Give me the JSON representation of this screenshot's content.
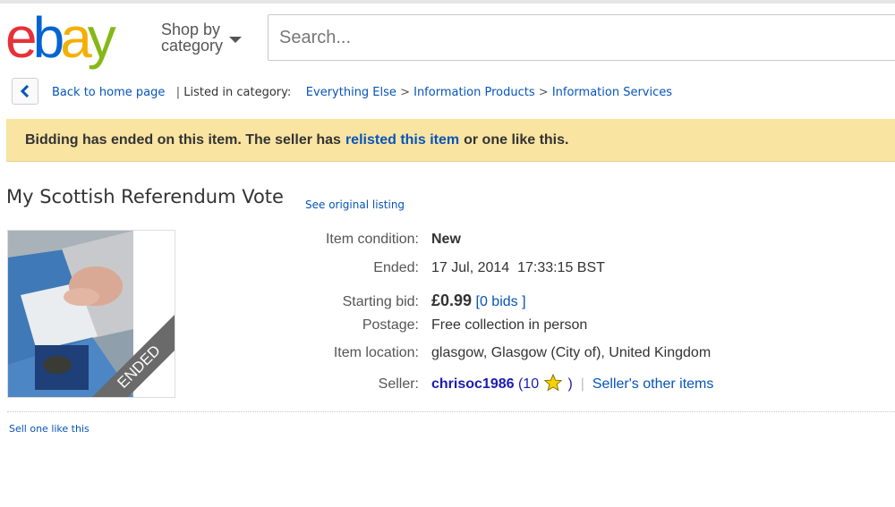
{
  "header": {
    "logo_letters": [
      "e",
      "b",
      "a",
      "y"
    ],
    "shop_by_category": "Shop by category",
    "search_placeholder": "Search..."
  },
  "breadcrumb": {
    "back_label": "Back to home page",
    "separator": "|",
    "listed_in": "Listed in category:",
    "categories": [
      "Everything Else",
      "Information Products",
      "Information Services"
    ],
    "arrow": ">"
  },
  "notice": {
    "text_before": "Bidding has ended on this item. The seller has",
    "link": "relisted this item",
    "text_after": "or one like this."
  },
  "listing": {
    "title": "My Scottish Referendum Vote",
    "see_original": "See original listing",
    "ribbon": "ENDED"
  },
  "details": {
    "condition": {
      "label": "Item condition:",
      "value": "New"
    },
    "ended": {
      "label": "Ended:",
      "value": "17 Jul, 2014  17:33:15 BST"
    },
    "starting_bid": {
      "label": "Starting bid:",
      "value": "£0.99",
      "bids_open": "[",
      "bids": "0 bids",
      "bids_close": "]"
    },
    "postage": {
      "label": "Postage:",
      "value": "Free collection in person"
    },
    "location": {
      "label": "Item location:",
      "value": "glasgow, Glasgow (City of), United Kingdom"
    },
    "seller": {
      "label": "Seller:",
      "name": "chrisoc1986",
      "feedback_open": "(10",
      "feedback_close": ")",
      "separator": "|",
      "other_items": "Seller's other items"
    }
  },
  "footer": {
    "sell_one": "Sell one like this"
  },
  "colors": {
    "link": "#0654ba",
    "notice_bg": "#f9e4a1",
    "ebay_red": "#e53238",
    "ebay_blue": "#0064d2",
    "ebay_yellow": "#f5af02",
    "ebay_green": "#86b817"
  },
  "icons": [
    "ebay-logo",
    "chevron-left-icon",
    "caret-down-icon",
    "star-icon"
  ]
}
